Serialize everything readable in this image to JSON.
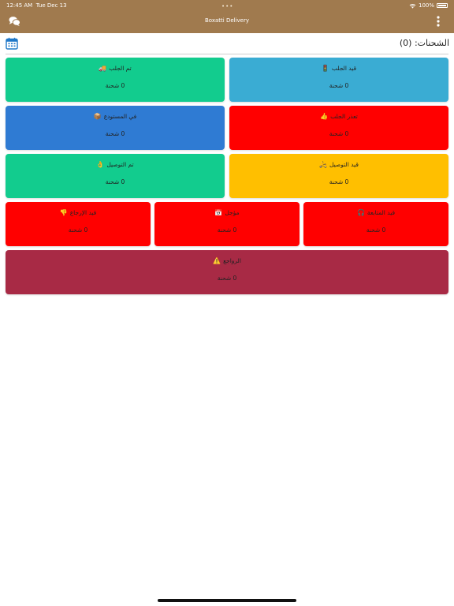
{
  "status_bar": {
    "time": "12:45 AM",
    "date": "Tue Dec 13",
    "battery": "100%",
    "dots": "•••"
  },
  "app": {
    "title": "Boxatti Delivery"
  },
  "page": {
    "shipments_count_label": "الشحنات: (0)"
  },
  "cards": [
    {
      "label": "قيد الجلب",
      "count": "0 شحنة",
      "color": "#3aacd3",
      "icon": "🚦"
    },
    {
      "label": "تم الجلب",
      "count": "0 شحنة",
      "color": "#12cc8e",
      "icon": "🚚"
    },
    {
      "label": "تعذر الجلب",
      "count": "0 شحنة",
      "color": "#ff0000",
      "icon": "👍"
    },
    {
      "label": "في المستودع",
      "count": "0 شحنة",
      "color": "#2f7bd3",
      "icon": "📦"
    },
    {
      "label": "قيد التوصيل",
      "count": "0 شحنة",
      "color": "#ffbf00",
      "icon": "🛵"
    },
    {
      "label": "تم التوصيل",
      "count": "0 شحنة",
      "color": "#12cc8e",
      "icon": "👌"
    },
    {
      "label": "قيد المتابعة",
      "count": "0 شحنة",
      "color": "#ff0000",
      "icon": "🎧"
    },
    {
      "label": "مؤجل",
      "count": "0 شحنة",
      "color": "#ff0000",
      "icon": "📅"
    },
    {
      "label": "قيد الإرجاع",
      "count": "0 شحنة",
      "color": "#ff0000",
      "icon": "👎"
    },
    {
      "label": "الرواجع",
      "count": "0 شحنة",
      "color": "#a82a45",
      "icon": "⚠️"
    }
  ],
  "colors": {
    "header": "#a07a4e",
    "accent": "#1f78c8"
  }
}
